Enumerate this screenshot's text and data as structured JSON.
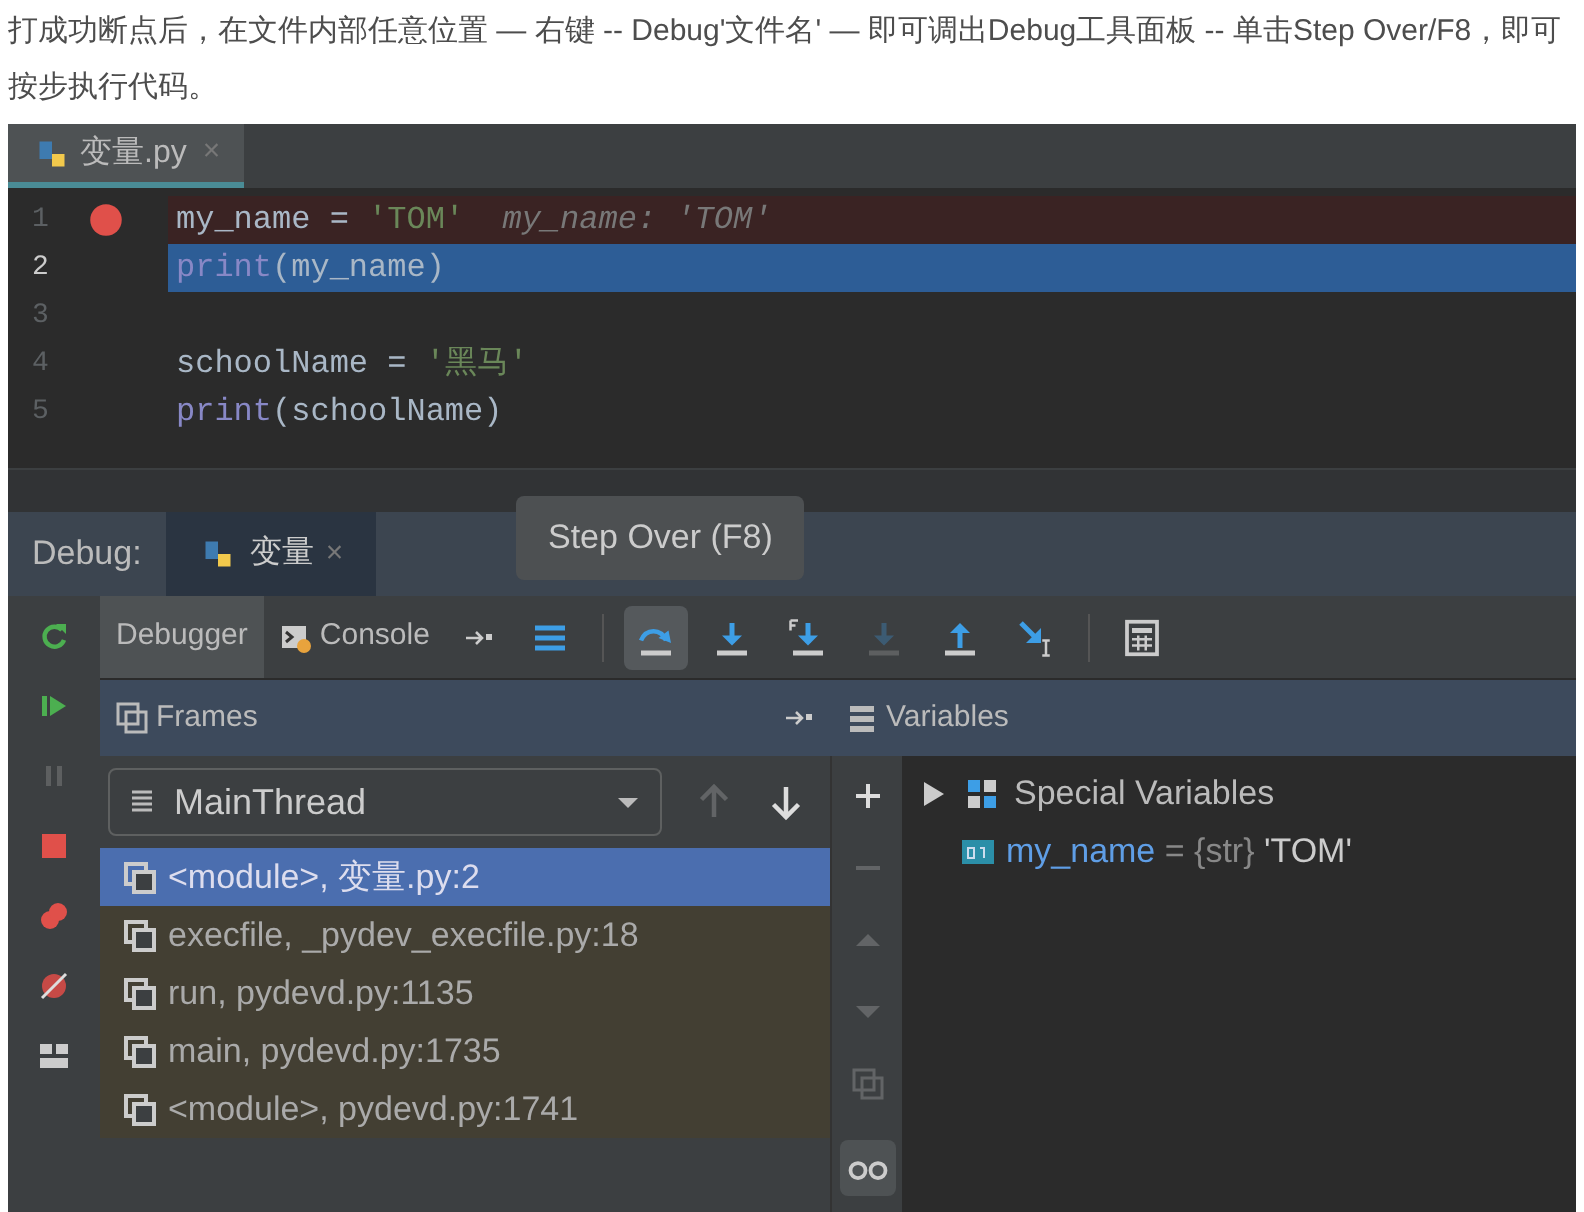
{
  "intro": "打成功断点后，在文件内部任意位置 — 右键 -- Debug'文件名' — 即可调出Debug工具面板 -- 单击Step Over/F8，即可按步执行代码。",
  "editor": {
    "tab": {
      "label": "变量.py",
      "close": "×",
      "selected": true
    },
    "lines": [
      {
        "number": "1",
        "breakpoint": true,
        "current": false,
        "tokens": [
          {
            "kind": "name",
            "text": "my_name"
          },
          {
            "kind": "op",
            "text": " = "
          },
          {
            "kind": "string",
            "text": "'TOM'"
          },
          {
            "kind": "inline",
            "text": "  my_name: 'TOM'"
          }
        ]
      },
      {
        "number": "2",
        "breakpoint": false,
        "current": true,
        "tokens": [
          {
            "kind": "builtin",
            "text": "print"
          },
          {
            "kind": "name",
            "text": "(my_name)"
          }
        ]
      },
      {
        "number": "3",
        "breakpoint": false,
        "current": false
      },
      {
        "number": "4",
        "breakpoint": false,
        "current": false,
        "tokens": [
          {
            "kind": "name",
            "text": "schoolName"
          },
          {
            "kind": "op",
            "text": " = "
          },
          {
            "kind": "string",
            "text": "'黑马'"
          }
        ]
      },
      {
        "number": "5",
        "breakpoint": false,
        "current": false,
        "tokens": [
          {
            "kind": "builtin",
            "text": "print"
          },
          {
            "kind": "name",
            "text": "(schoolName)"
          }
        ]
      }
    ]
  },
  "debug": {
    "label": "Debug:",
    "tab": {
      "label": "变量",
      "close": "×",
      "selected": true
    },
    "tooltip": "Step Over (F8)",
    "side_buttons": [
      {
        "kind": "rerun",
        "disabled": false
      },
      {
        "kind": "resume",
        "disabled": false
      },
      {
        "kind": "pause",
        "disabled": true
      },
      {
        "kind": "stop",
        "disabled": false
      },
      {
        "kind": "breakpoints",
        "disabled": false
      },
      {
        "kind": "mute",
        "disabled": false
      },
      {
        "kind": "layout",
        "disabled": false
      }
    ],
    "view_tabs": [
      {
        "label": "Debugger",
        "selected": true
      },
      {
        "label": "Console",
        "selected": false
      }
    ],
    "tools": [
      {
        "kind": "frames",
        "selected": false,
        "disabled": false
      },
      {
        "kind": "step-over",
        "selected": true,
        "disabled": false
      },
      {
        "kind": "step-into",
        "selected": false,
        "disabled": false
      },
      {
        "kind": "step-into-my",
        "selected": false,
        "disabled": false
      },
      {
        "kind": "force-step",
        "selected": false,
        "disabled": true
      },
      {
        "kind": "step-out",
        "selected": false,
        "disabled": false
      },
      {
        "kind": "run-to-cursor",
        "selected": false,
        "disabled": false
      },
      {
        "kind": "evaluate",
        "selected": false,
        "disabled": false
      }
    ],
    "frames": {
      "title": "Frames",
      "thread": "MainThread",
      "items": [
        {
          "label": "<module>, 变量.py:2",
          "selected": true
        },
        {
          "label": "execfile, _pydev_execfile.py:18",
          "selected": false
        },
        {
          "label": "run, pydevd.py:1135",
          "selected": false
        },
        {
          "label": "main, pydevd.py:1735",
          "selected": false
        },
        {
          "label": "<module>, pydevd.py:1741",
          "selected": false
        }
      ]
    },
    "variables": {
      "title": "Variables",
      "items": [
        {
          "kind": "group",
          "label": "Special Variables",
          "expanded": false
        },
        {
          "kind": "var",
          "name": "my_name",
          "eq": " = ",
          "type": "{str}",
          "value": "'TOM'"
        }
      ]
    }
  }
}
